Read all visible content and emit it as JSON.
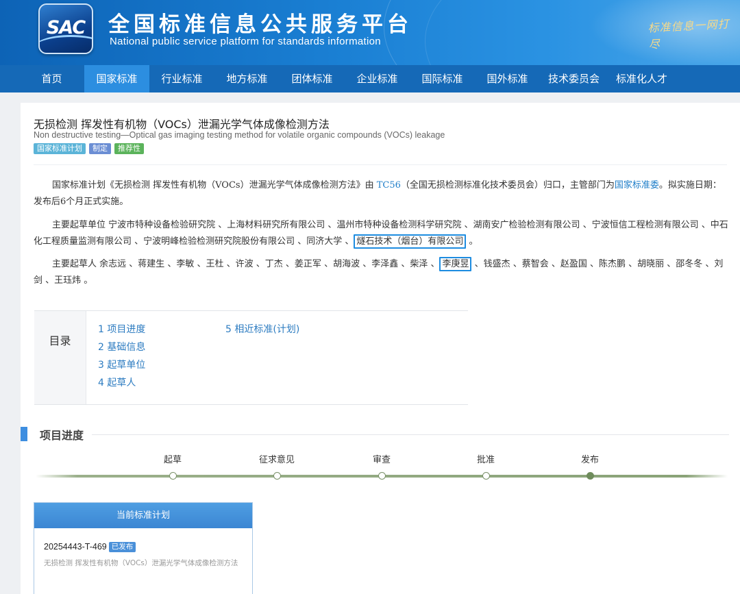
{
  "header": {
    "logo_text": "SAC",
    "title_cn": "全国标准信息公共服务平台",
    "title_en": "National public service platform  for standards information",
    "slogan": "标准信息一网打尽"
  },
  "nav": {
    "items": [
      {
        "label": "首页"
      },
      {
        "label": "国家标准"
      },
      {
        "label": "行业标准"
      },
      {
        "label": "地方标准"
      },
      {
        "label": "团体标准"
      },
      {
        "label": "企业标准"
      },
      {
        "label": "国际标准"
      },
      {
        "label": "国外标准"
      },
      {
        "label": "技术委员会"
      },
      {
        "label": "标准化人才"
      }
    ],
    "active_index": 1
  },
  "document": {
    "title": "无损检测 挥发性有机物（VOCs）泄漏光学气体成像检测方法",
    "subtitle": "Non destructive testing—Optical gas imaging testing method for volatile organic compounds (VOCs) leakage",
    "tags": [
      "国家标准计划",
      "制定",
      "推荐性"
    ]
  },
  "intro": {
    "part1": "国家标准计划《无损检测 挥发性有机物（VOCs）泄漏光学气体成像检测方法》由 ",
    "tc_link": "TC56",
    "part2": "（全国无损检测标准化技术委员会）归口，主管部门为",
    "dept_link": "国家标准委",
    "part3": "。拟实施日期：发布后6个月正式实施。"
  },
  "drafting_units": {
    "label": "主要起草单位 ",
    "list_text": "宁波市特种设备检验研究院 、上海材料研究所有限公司 、温州市特种设备检测科学研究院 、湖南安广检验检测有限公司 、宁波恒信工程检测有限公司 、中石化工程质量监测有限公司 、宁波明峰检验检测研究院股份有限公司 、同济大学 、",
    "highlighted": "燧石技术（烟台）有限公司",
    "end": " 。"
  },
  "drafters": {
    "label": "主要起草人 ",
    "before": "余志远 、蒋建生 、李敏 、王杜 、许波 、丁杰 、姜正军 、胡海波 、李泽鑫 、柴泽 、",
    "highlighted": "李庚昱",
    "after": " 、钱盛杰 、蔡智会 、赵盈国 、陈杰鹏 、胡晓丽 、邵冬冬 、刘剑 、王珏炜 。"
  },
  "toc": {
    "label": "目录",
    "col1": [
      "1  项目进度",
      "2  基础信息",
      "3  起草单位",
      "4  起草人"
    ],
    "col2": [
      "5  相近标准(计划)"
    ]
  },
  "progress": {
    "section_title": "项目进度",
    "steps": [
      {
        "label": "起草",
        "done": false
      },
      {
        "label": "征求意见",
        "done": false
      },
      {
        "label": "审查",
        "done": false
      },
      {
        "label": "批准",
        "done": false
      },
      {
        "label": "发布",
        "done": true
      }
    ]
  },
  "current_plan": {
    "heading": "当前标准计划",
    "code": "20254443-T-469",
    "status": "已发布",
    "name": "无损检测 挥发性有机物（VOCs）泄漏光学气体成像检测方法"
  },
  "colors": {
    "nav_bg": "#1569b7",
    "nav_active": "#2c8ee0",
    "link": "#1d7dc8",
    "highlight_border": "#1d8ce0"
  }
}
